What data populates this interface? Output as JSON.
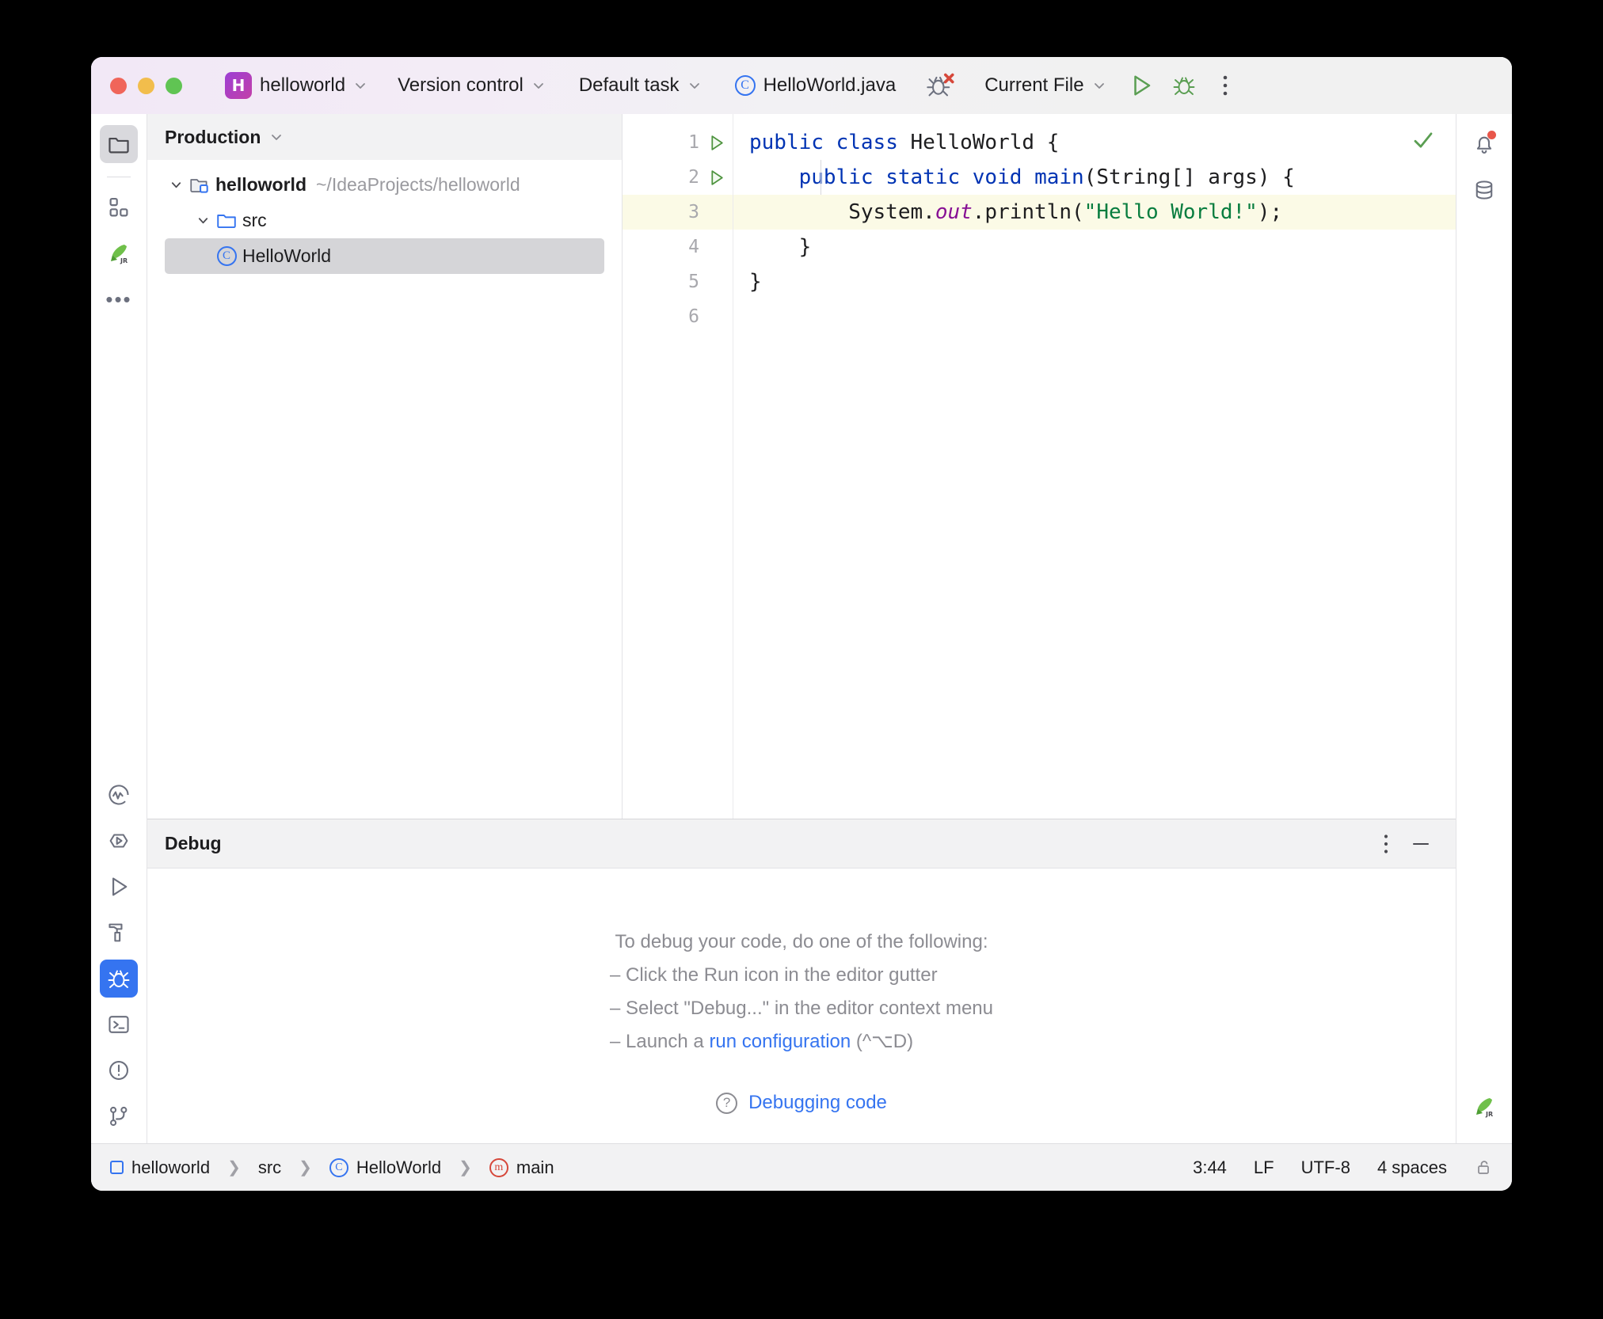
{
  "titlebar": {
    "project_badge": "H",
    "project_name": "helloworld",
    "version_control": "Version control",
    "default_task": "Default task",
    "current_file_tab": "HelloWorld.java",
    "run_config": "Current File",
    "class_icon_letter": "C"
  },
  "project_panel": {
    "scope_label": "Production",
    "tree": [
      {
        "label": "helloworld",
        "path": "~/IdeaProjects/helloworld",
        "icon": "module-folder-icon",
        "depth": 0,
        "expanded": true,
        "selected": false
      },
      {
        "label": "src",
        "path": "",
        "icon": "source-folder-icon",
        "depth": 1,
        "expanded": true,
        "selected": false
      },
      {
        "label": "HelloWorld",
        "path": "",
        "icon": "java-class-icon",
        "depth": 2,
        "expanded": null,
        "selected": true
      }
    ]
  },
  "editor": {
    "line_numbers": [
      "1",
      "2",
      "3",
      "4",
      "5",
      "6"
    ],
    "gutter_run_lines": [
      1,
      2
    ],
    "highlighted_line": 3,
    "code_lines": [
      {
        "n": 1,
        "tokens": [
          {
            "t": "public",
            "c": "kw"
          },
          {
            "t": " ",
            "c": "plain"
          },
          {
            "t": "class",
            "c": "kw"
          },
          {
            "t": " HelloWorld {",
            "c": "plain"
          }
        ]
      },
      {
        "n": 2,
        "tokens": [
          {
            "t": "    ",
            "c": "plain"
          },
          {
            "t": "public",
            "c": "kw"
          },
          {
            "t": " ",
            "c": "plain"
          },
          {
            "t": "static",
            "c": "kw"
          },
          {
            "t": " ",
            "c": "plain"
          },
          {
            "t": "void",
            "c": "kw"
          },
          {
            "t": " ",
            "c": "plain"
          },
          {
            "t": "main",
            "c": "kw"
          },
          {
            "t": "(String[] args) {",
            "c": "plain"
          }
        ]
      },
      {
        "n": 3,
        "tokens": [
          {
            "t": "        System.",
            "c": "plain"
          },
          {
            "t": "out",
            "c": "field-static"
          },
          {
            "t": ".println(",
            "c": "plain"
          },
          {
            "t": "\"Hello World!\"",
            "c": "str"
          },
          {
            "t": ");",
            "c": "plain"
          }
        ]
      },
      {
        "n": 4,
        "tokens": [
          {
            "t": "    }",
            "c": "plain"
          }
        ]
      },
      {
        "n": 5,
        "tokens": [
          {
            "t": "}",
            "c": "plain"
          }
        ]
      },
      {
        "n": 6,
        "tokens": [
          {
            "t": "",
            "c": "plain"
          }
        ]
      }
    ],
    "inspection_status": "ok-check"
  },
  "debug_panel": {
    "title": "Debug",
    "intro": "To debug your code, do one of the following:",
    "bullet_1": "– Click the Run icon in the editor gutter",
    "bullet_2": "– Select \"Debug...\" in the editor context menu",
    "bullet_3_pre": "– Launch a ",
    "bullet_3_link": "run configuration",
    "bullet_3_post": " (^⌥D)",
    "help_link": "Debugging code"
  },
  "statusbar": {
    "breadcrumb": [
      "helloworld",
      "src",
      "HelloWorld",
      "main"
    ],
    "caret_position": "3:44",
    "line_separator": "LF",
    "encoding": "UTF-8",
    "indent": "4 spaces"
  },
  "left_stripe": [
    {
      "name": "project-tool-icon",
      "state": "selected"
    },
    {
      "name": "structure-tool-icon",
      "state": "normal"
    },
    {
      "name": "junie-rocket-icon",
      "state": "normal"
    },
    {
      "name": "more-tool-windows-icon",
      "state": "normal"
    },
    {
      "name": "profiler-icon",
      "state": "normal"
    },
    {
      "name": "run-anything-icon",
      "state": "normal"
    },
    {
      "name": "run-tool-icon",
      "state": "normal"
    },
    {
      "name": "build-tool-icon",
      "state": "normal"
    },
    {
      "name": "debug-tool-icon",
      "state": "active"
    },
    {
      "name": "terminal-tool-icon",
      "state": "normal"
    },
    {
      "name": "problems-tool-icon",
      "state": "normal"
    },
    {
      "name": "version-control-tool-icon",
      "state": "normal"
    }
  ],
  "right_stripe": [
    {
      "name": "notifications-icon",
      "state": "has-badge"
    },
    {
      "name": "database-icon",
      "state": "normal"
    },
    {
      "name": "junie-rocket-icon",
      "state": "normal"
    }
  ],
  "colors": {
    "accent_blue": "#3574f0",
    "keyword_blue": "#0033b3",
    "string_green": "#087d3f",
    "static_field_purple": "#871094",
    "highlight_line": "#fbfae6",
    "run_green": "#5a9e52",
    "error_red": "#e8564a"
  }
}
